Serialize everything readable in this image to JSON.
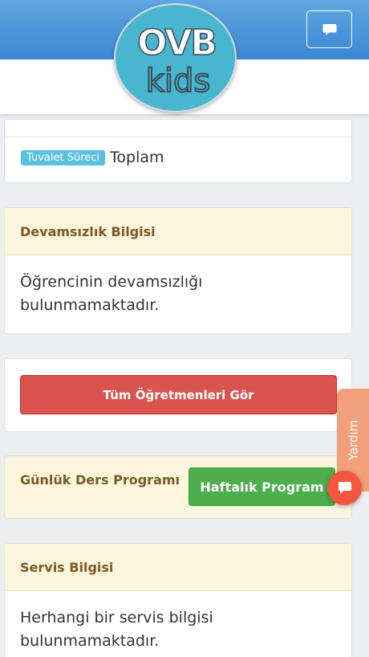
{
  "colors": {
    "topbar": "#3a87d4",
    "danger": "#d9534f",
    "success": "#4cae4c",
    "info_badge": "#5bc0de",
    "help_tab": "#f2a07b",
    "fab": "#f2583e",
    "card_header_bg": "#fcf6df",
    "card_header_text": "#7a5a22"
  },
  "header": {
    "chat_icon": "chat-bubble-icon",
    "logo": {
      "top_text": "OVB",
      "bottom_text": "kids"
    }
  },
  "toilet_card": {
    "badge": "Tuvalet Süreci",
    "text": "Toplam"
  },
  "absence_card": {
    "title": "Devamsızlık Bilgisi",
    "line1": "Öğrencinin devamsızlığı",
    "line2": "bulunmamaktadır."
  },
  "teachers_card": {
    "button": "Tüm Öğretmenleri Gör"
  },
  "schedule_card": {
    "title": "Günlük Ders Programı",
    "button": "Haftalık Program"
  },
  "service_card": {
    "title": "Servis Bilgisi",
    "line1": "Herhangi bir servis bilgisi",
    "line2": "bulunmamaktadır."
  },
  "help": {
    "tab_label": "Yardım",
    "fab_icon": "chat-icon"
  }
}
